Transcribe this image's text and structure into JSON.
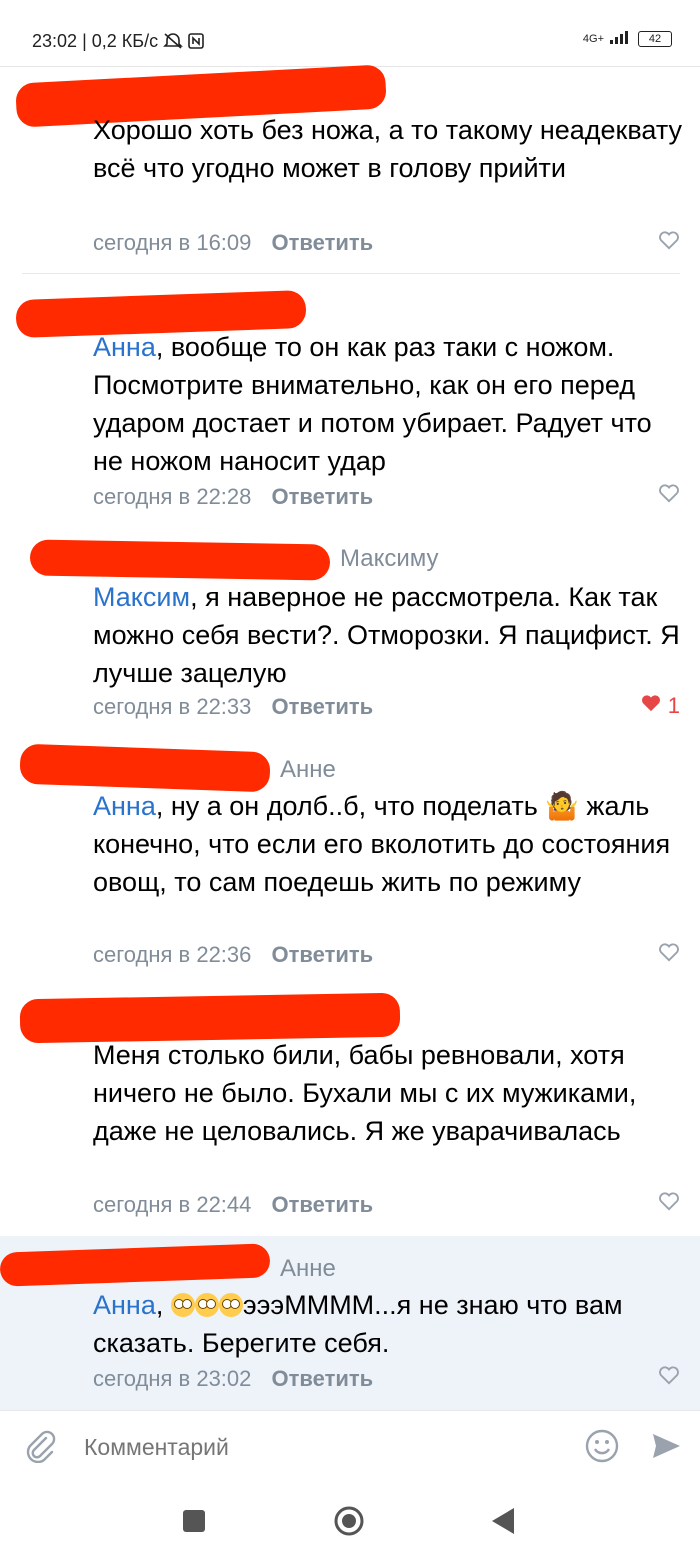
{
  "status_bar": {
    "time": "23:02",
    "speed": "0,2 КБ/с",
    "network": "4G+",
    "battery": "42"
  },
  "comments": [
    {
      "reply_to": "",
      "mention": "",
      "text": "Хорошо хоть без ножа, а то такому неадеквату всё что угодно может в голову прийти",
      "time": "сегодня в 16:09",
      "reply_label": "Ответить",
      "likes": "",
      "liked": false
    },
    {
      "reply_to": "",
      "mention": "Анна",
      "text": ", вообще то он как раз таки с ножом. Посмотрите внимательно, как он его перед ударом достает и потом убирает. Радует что не ножом наносит удар",
      "time": "сегодня в 22:28",
      "reply_label": "Ответить",
      "likes": "",
      "liked": false
    },
    {
      "reply_to": "Максиму",
      "mention": "Максим",
      "text": ",  я наверное не рассмотрела. Как так можно себя вести?. Отморозки. Я пацифист. Я лучше зацелую",
      "time": "сегодня в 22:33",
      "reply_label": "Ответить",
      "likes": "1",
      "liked": true
    },
    {
      "reply_to": "Анне",
      "mention": "Анна",
      "text": ", ну а он долб..б, что поделать 🤷 жаль конечно, что если его вколотить до состояния овощ, то сам поедешь жить по режиму",
      "time": "сегодня в 22:36",
      "reply_label": "Ответить",
      "likes": "",
      "liked": false
    },
    {
      "reply_to": "",
      "mention": "",
      "text": "Меня столько били, бабы ревновали, хотя ничего не было. Бухали мы с их мужиками, даже не целовались. Я же уварачивалась",
      "time": "сегодня в 22:44",
      "reply_label": "Ответить",
      "likes": "",
      "liked": false
    },
    {
      "reply_to": "Анне",
      "mention": "Анна",
      "text": "эээММММ...я не знаю что вам сказать. Берегите себя.",
      "time": "сегодня в 23:02",
      "reply_label": "Ответить",
      "likes": "",
      "liked": false
    }
  ],
  "composer": {
    "placeholder": "Комментарий"
  },
  "colors": {
    "link": "#2a73cc",
    "meta": "#818c99",
    "redaction": "#ff2a00",
    "highlight_bg": "#eef3f9",
    "like_active": "#e64646"
  }
}
